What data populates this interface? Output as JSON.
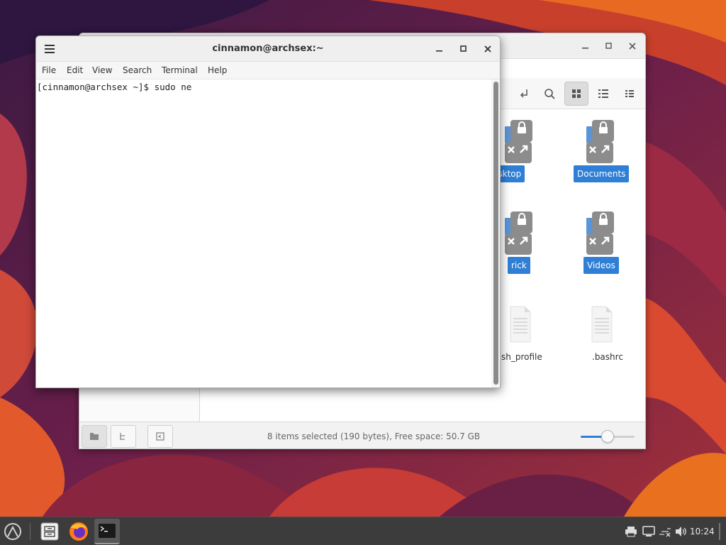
{
  "file_manager": {
    "items": [
      {
        "label": "esktop",
        "kind": "folder-locked",
        "selected": true
      },
      {
        "label": "Documents",
        "kind": "folder-locked",
        "selected": true
      },
      {
        "label": "rick",
        "kind": "folder-locked",
        "selected": true
      },
      {
        "label": "Videos",
        "kind": "folder-locked",
        "selected": true
      },
      {
        "label": "sh_profile",
        "kind": "text-file",
        "selected": false
      },
      {
        "label": ".bashrc",
        "kind": "text-file",
        "selected": false
      }
    ],
    "status_text": "8 items selected (190 bytes), Free space: 50.7 GB",
    "zoom_level": 0.5,
    "view_mode": "icon-view"
  },
  "terminal": {
    "title": "cinnamon@archsex:~",
    "menu": [
      "File",
      "Edit",
      "View",
      "Search",
      "Terminal",
      "Help"
    ],
    "prompt": "[cinnamon@archsex ~]$ ",
    "command": "sudo ne"
  },
  "taskbar": {
    "clock": "10:24",
    "apps": [
      {
        "name": "files-icon",
        "active": false
      },
      {
        "name": "firefox-icon",
        "active": false
      },
      {
        "name": "terminal-icon",
        "active": true
      }
    ]
  },
  "colors": {
    "selection": "#2f7fd6",
    "folder": "#5a95d9",
    "taskbar": "#3c3c3c"
  }
}
